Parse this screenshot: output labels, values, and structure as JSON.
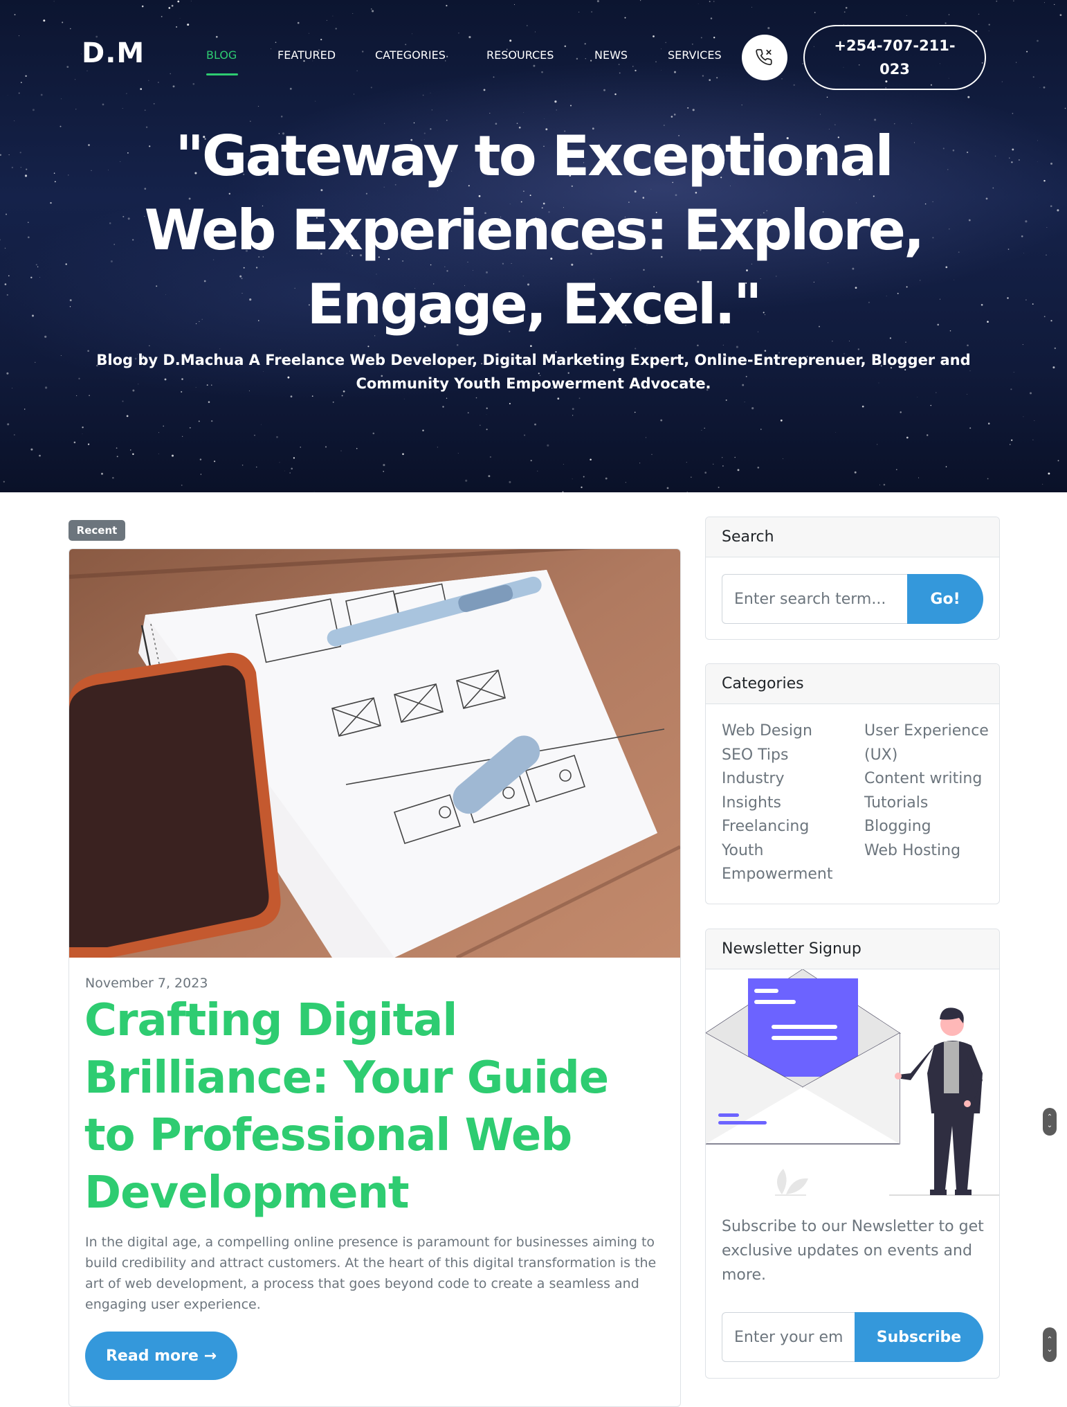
{
  "header": {
    "logo": "D.M",
    "nav": [
      {
        "label": "BLOG",
        "active": true
      },
      {
        "label": "FEATURED",
        "active": false
      },
      {
        "label": "CATEGORIES",
        "active": false
      },
      {
        "label": "RESOURCES",
        "active": false
      },
      {
        "label": "NEWS",
        "active": false
      },
      {
        "label": "SERVICES",
        "active": false
      }
    ],
    "phone_icon": "phone-icon",
    "phone_number": "+254-707-211-023"
  },
  "hero": {
    "title": "\"Gateway to Exceptional Web Experiences: Explore, Engage, Excel.\"",
    "subtitle": "Blog by D.Machua A Freelance Web Developer, Digital Marketing Expert, Online-Entreprenuer, Blogger and Community Youth Empowerment Advocate."
  },
  "post": {
    "badge": "Recent",
    "date": "November 7, 2023",
    "title": "Crafting Digital Brilliance: Your Guide to Professional Web Development",
    "excerpt": "In the digital age, a compelling online presence is paramount for businesses aiming to build credibility and attract customers. At the heart of this digital transformation is the art of web development, a process that goes beyond code to create a seamless and engaging user experience.",
    "read_more": "Read more →"
  },
  "sidebar": {
    "search": {
      "title": "Search",
      "placeholder": "Enter search term...",
      "button": "Go!"
    },
    "categories": {
      "title": "Categories",
      "left": [
        "Web Design",
        "SEO Tips",
        "Industry Insights",
        "Freelancing",
        "Youth Empowerment"
      ],
      "right": [
        "User Experience (UX)",
        "Content writing",
        "Tutorials",
        "Blogging",
        "Web Hosting"
      ]
    },
    "newsletter": {
      "title": "Newsletter Signup",
      "text": "Subscribe to our Newsletter to get exclusive updates on events and more.",
      "placeholder": "Enter your email",
      "button": "Subscribe"
    }
  },
  "colors": {
    "accent_green": "#2ecc71",
    "button_blue": "#3498db",
    "badge_gray": "#6c757d"
  }
}
